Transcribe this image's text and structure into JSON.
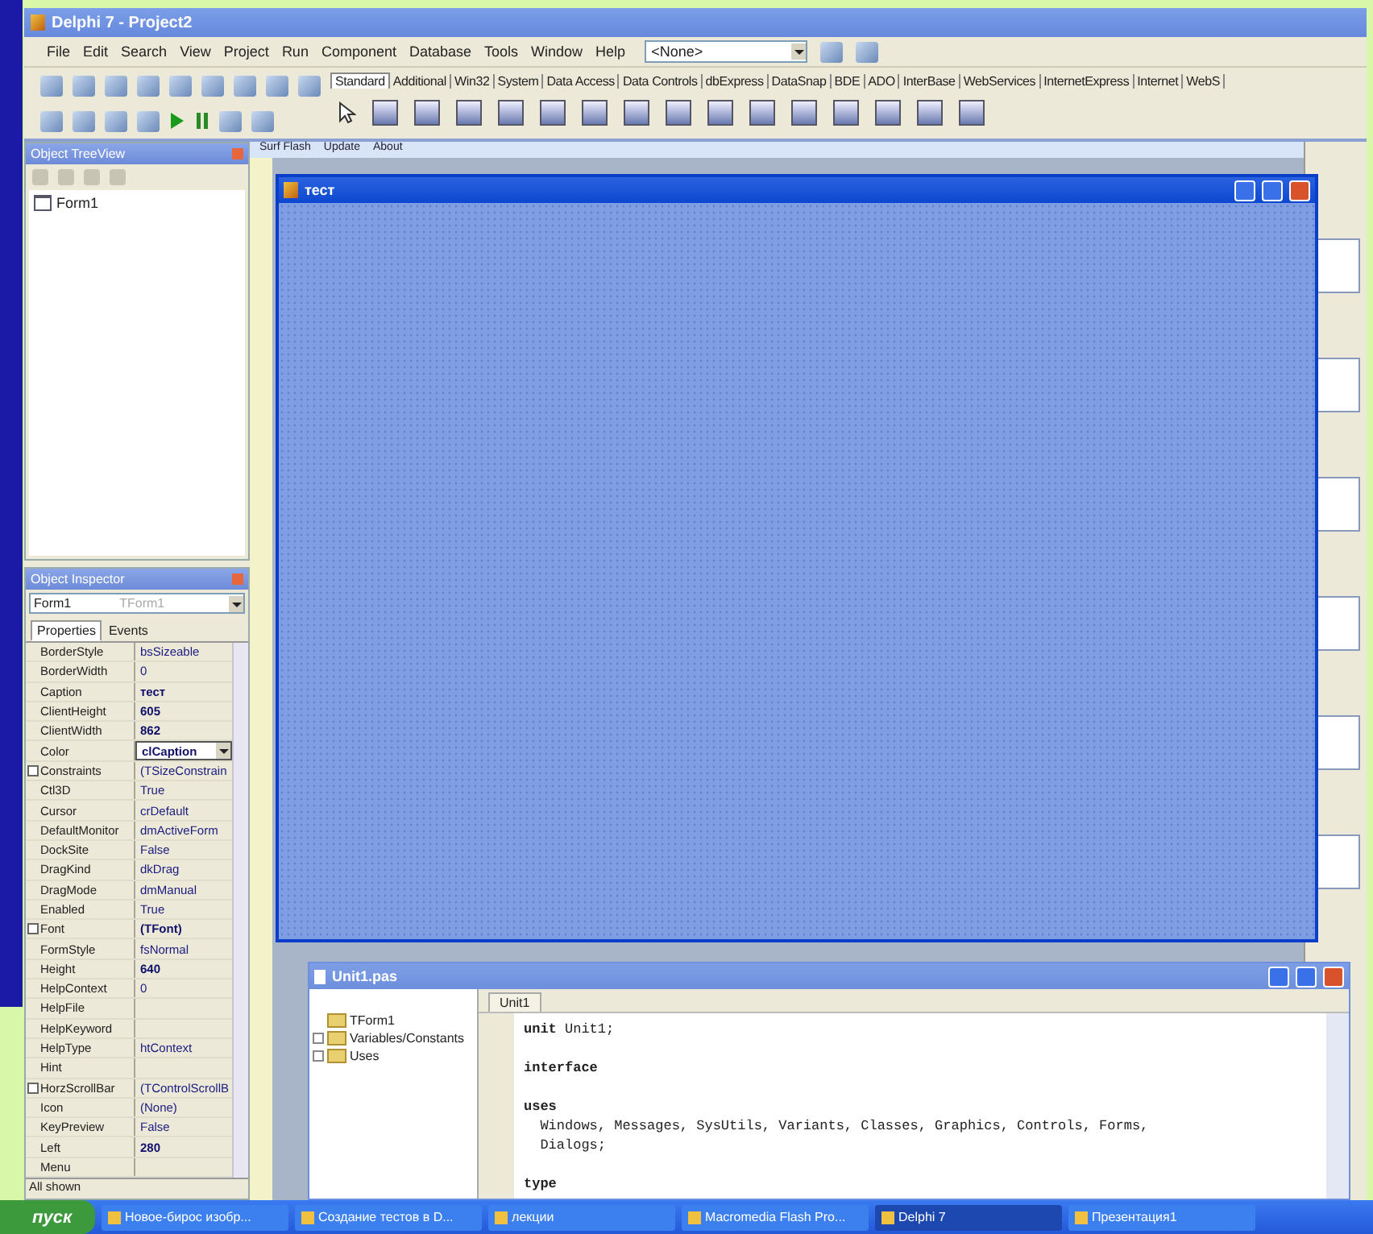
{
  "ide": {
    "title": "Delphi 7 - Project2",
    "menu": [
      "File",
      "Edit",
      "Search",
      "View",
      "Project",
      "Run",
      "Component",
      "Database",
      "Tools",
      "Window",
      "Help"
    ],
    "desktop_combo": "<None>",
    "palette_tabs": [
      {
        "label": "Standard",
        "selected": true
      },
      {
        "label": "Additional",
        "selected": false
      },
      {
        "label": "Win32",
        "selected": false
      },
      {
        "label": "System",
        "selected": false
      },
      {
        "label": "Data Access",
        "selected": false
      },
      {
        "label": "Data Controls",
        "selected": false
      },
      {
        "label": "dbExpress",
        "selected": false
      },
      {
        "label": "DataSnap",
        "selected": false
      },
      {
        "label": "BDE",
        "selected": false
      },
      {
        "label": "ADO",
        "selected": false
      },
      {
        "label": "InterBase",
        "selected": false
      },
      {
        "label": "WebServices",
        "selected": false
      },
      {
        "label": "InternetExpress",
        "selected": false
      },
      {
        "label": "Internet",
        "selected": false
      },
      {
        "label": "WebS",
        "selected": false
      }
    ]
  },
  "designer_tabs": [
    "Surf Flash",
    "Update",
    "About"
  ],
  "tree_view": {
    "title": "Object TreeView",
    "items": [
      "Form1"
    ]
  },
  "inspector": {
    "title": "Object Inspector",
    "object": "Form1",
    "object_type": "TForm1",
    "tabs": [
      {
        "label": "Properties",
        "selected": true
      },
      {
        "label": "Events",
        "selected": false
      }
    ],
    "rows": [
      {
        "name": "BorderStyle",
        "value": "bsSizeable",
        "expandable": false,
        "modified": false,
        "selected": false
      },
      {
        "name": "BorderWidth",
        "value": "0",
        "expandable": false,
        "modified": false,
        "selected": false
      },
      {
        "name": "Caption",
        "value": "тест",
        "expandable": false,
        "modified": true,
        "selected": false
      },
      {
        "name": "ClientHeight",
        "value": "605",
        "expandable": false,
        "modified": true,
        "selected": false
      },
      {
        "name": "ClientWidth",
        "value": "862",
        "expandable": false,
        "modified": true,
        "selected": false
      },
      {
        "name": "Color",
        "value": "clCaption",
        "expandable": false,
        "modified": true,
        "selected": true
      },
      {
        "name": "Constraints",
        "value": "(TSizeConstrain",
        "expandable": true,
        "modified": false,
        "selected": false
      },
      {
        "name": "Ctl3D",
        "value": "True",
        "expandable": false,
        "modified": false,
        "selected": false
      },
      {
        "name": "Cursor",
        "value": "crDefault",
        "expandable": false,
        "modified": false,
        "selected": false
      },
      {
        "name": "DefaultMonitor",
        "value": "dmActiveForm",
        "expandable": false,
        "modified": false,
        "selected": false
      },
      {
        "name": "DockSite",
        "value": "False",
        "expandable": false,
        "modified": false,
        "selected": false
      },
      {
        "name": "DragKind",
        "value": "dkDrag",
        "expandable": false,
        "modified": false,
        "selected": false
      },
      {
        "name": "DragMode",
        "value": "dmManual",
        "expandable": false,
        "modified": false,
        "selected": false
      },
      {
        "name": "Enabled",
        "value": "True",
        "expandable": false,
        "modified": false,
        "selected": false
      },
      {
        "name": "Font",
        "value": "(TFont)",
        "expandable": true,
        "modified": true,
        "selected": false
      },
      {
        "name": "FormStyle",
        "value": "fsNormal",
        "expandable": false,
        "modified": false,
        "selected": false
      },
      {
        "name": "Height",
        "value": "640",
        "expandable": false,
        "modified": true,
        "selected": false
      },
      {
        "name": "HelpContext",
        "value": "0",
        "expandable": false,
        "modified": false,
        "selected": false
      },
      {
        "name": "HelpFile",
        "expandable": false,
        "selected": false
      },
      {
        "name": "HelpKeyword",
        "expandable": false,
        "selected": false
      },
      {
        "name": "HelpType",
        "value": "htContext",
        "expandable": false,
        "modified": false,
        "selected": false
      },
      {
        "name": "Hint",
        "expandable": false,
        "selected": false
      },
      {
        "name": "HorzScrollBar",
        "value": "(TControlScrollB",
        "expandable": true,
        "modified": false,
        "selected": false
      },
      {
        "name": "Icon",
        "value": "(None)",
        "expandable": false,
        "modified": false,
        "selected": false
      },
      {
        "name": "KeyPreview",
        "value": "False",
        "expandable": false,
        "modified": false,
        "selected": false
      },
      {
        "name": "Left",
        "value": "280",
        "expandable": false,
        "modified": true,
        "selected": false
      },
      {
        "name": "Menu",
        "expandable": false,
        "selected": false
      }
    ],
    "status": "All shown"
  },
  "form": {
    "title": "тест"
  },
  "unit_window": {
    "title": "Unit1.pas",
    "explorer": [
      {
        "label": "TForm1",
        "expandable": false
      },
      {
        "label": "Variables/Constants",
        "expandable": true
      },
      {
        "label": "Uses",
        "expandable": true
      }
    ],
    "tabs": [
      {
        "label": "Unit1",
        "selected": true
      }
    ],
    "code": [
      [
        {
          "text": "**unit** Unit1;",
          "bold": false
        }
      ],
      [
        {
          "text": "interface",
          "bold": true
        }
      ],
      [
        {
          "text": "uses",
          "bold": true
        },
        {
          "text": "  Windows, Messages, SysUtils, Variants, Classes, Graphics, Controls, Forms,",
          "bold": false
        },
        {
          "text": "  Dialogs;",
          "bold": false
        }
      ],
      [
        {
          "text": "type",
          "bold": true
        }
      ]
    ]
  },
  "taskbar": {
    "start": "пуск",
    "tasks": [
      {
        "label": "Новое-бирос изобр...",
        "selected": false
      },
      {
        "label": "Создание тестов в D...",
        "selected": false
      },
      {
        "label": "лекции",
        "selected": false
      },
      {
        "label": "Macromedia Flash Pro...",
        "selected": false
      },
      {
        "label": "Delphi 7",
        "selected": true
      },
      {
        "label": "Презентация1",
        "selected": false
      }
    ]
  }
}
